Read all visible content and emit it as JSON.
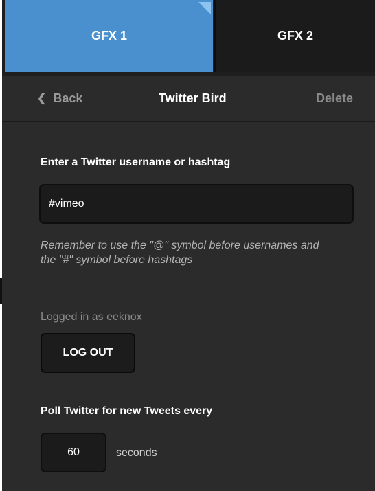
{
  "tabs": [
    {
      "label": "GFX 1",
      "active": true
    },
    {
      "label": "GFX 2",
      "active": false
    }
  ],
  "header": {
    "back_label": "Back",
    "title": "Twitter Bird",
    "delete_label": "Delete"
  },
  "form": {
    "username_label": "Enter a Twitter username or hashtag",
    "username_value": "#vimeo",
    "hint": "Remember to use the \"@\" symbol before usernames and the \"#\" symbol before hashtags",
    "logged_in_text": "Logged in as eeknox",
    "logout_label": "LOG OUT",
    "poll_label": "Poll Twitter for new Tweets every",
    "poll_value": "60",
    "poll_unit": "seconds"
  },
  "icons": {
    "back": "chevron-left-icon",
    "tab_corner": "corner-indicator-icon"
  },
  "colors": {
    "accent": "#4a8fce",
    "panel_bg": "#2b2b2b",
    "input_bg": "#1b1b1b"
  }
}
